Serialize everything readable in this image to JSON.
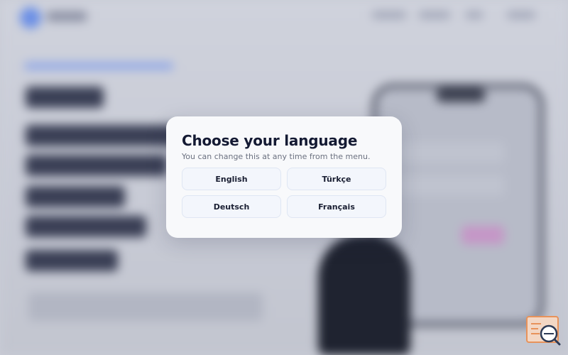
{
  "modal": {
    "title": "Choose your language",
    "subtitle": "You can change this at any time from the menu.",
    "languages": [
      "English",
      "Türkçe",
      "Deutsch",
      "Français"
    ]
  },
  "colors": {
    "modal_background": "#f8f9fb",
    "title": "#141a33",
    "subtitle": "#6b7180",
    "button_background": "#f3f6fc",
    "button_border": "#dfe6f3",
    "widget_accent": "#e8925a"
  },
  "icons": {
    "corner_widget": "search-document-icon"
  }
}
